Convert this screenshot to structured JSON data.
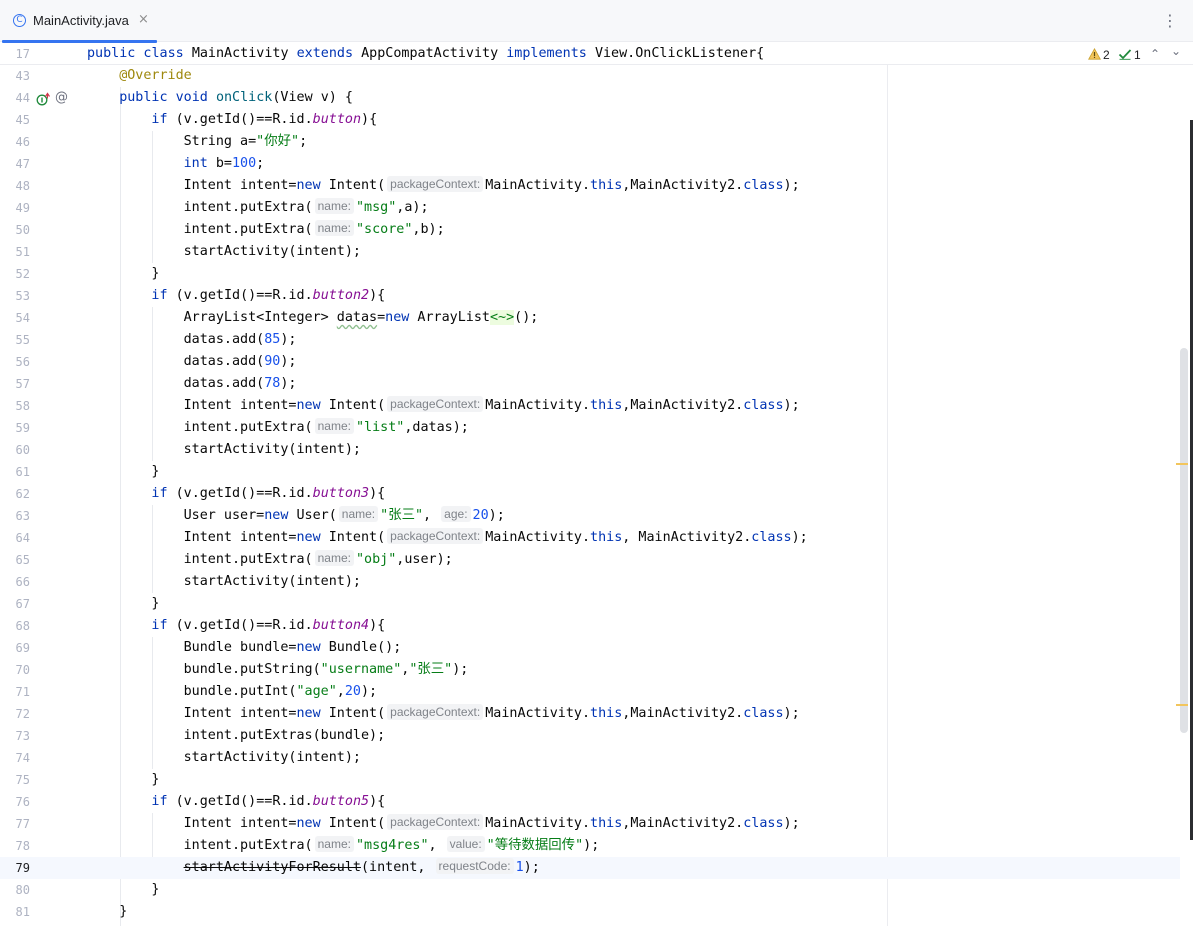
{
  "tab": {
    "icon_letter": "C",
    "filename": "MainActivity.java",
    "close_glyph": "×"
  },
  "more_glyph": "⋮",
  "inspection": {
    "warning_count": "2",
    "ok_count": "1",
    "up_glyph": "⌃",
    "down_glyph": "⌄"
  },
  "sticky": {
    "line_number": "17",
    "tokens": [
      {
        "t": "public class ",
        "c": "kw"
      },
      {
        "t": "MainActivity "
      },
      {
        "t": "extends ",
        "c": "kw"
      },
      {
        "t": "AppCompatActivity "
      },
      {
        "t": "implements ",
        "c": "kw"
      },
      {
        "t": "View.OnClickListener{"
      }
    ]
  },
  "current_line": "79",
  "lines": [
    {
      "n": "43",
      "i": 1,
      "tokens": [
        {
          "t": "@Override",
          "c": "ann"
        }
      ]
    },
    {
      "n": "44",
      "i": 1,
      "tokens": [
        {
          "t": "public void ",
          "c": "kw"
        },
        {
          "t": "onClick",
          "c": "fn"
        },
        {
          "t": "(View v) {"
        }
      ]
    },
    {
      "n": "45",
      "i": 2,
      "tokens": [
        {
          "t": "if ",
          "c": "kw"
        },
        {
          "t": "(v.getId()==R.id."
        },
        {
          "t": "button",
          "c": "fld"
        },
        {
          "t": "){"
        }
      ]
    },
    {
      "n": "46",
      "i": 3,
      "tokens": [
        {
          "t": "String a="
        },
        {
          "t": "\"你好\"",
          "c": "str"
        },
        {
          "t": ";"
        }
      ]
    },
    {
      "n": "47",
      "i": 3,
      "tokens": [
        {
          "t": "int ",
          "c": "kw"
        },
        {
          "t": "b="
        },
        {
          "t": "100",
          "c": "num"
        },
        {
          "t": ";"
        }
      ]
    },
    {
      "n": "48",
      "i": 3,
      "tokens": [
        {
          "t": "Intent intent="
        },
        {
          "t": "new ",
          "c": "kw"
        },
        {
          "t": "Intent("
        },
        {
          "h": "packageContext:"
        },
        {
          "t": "MainActivity."
        },
        {
          "t": "this",
          "c": "kw"
        },
        {
          "t": ",MainActivity2."
        },
        {
          "t": "class",
          "c": "kw"
        },
        {
          "t": ");"
        }
      ]
    },
    {
      "n": "49",
      "i": 3,
      "tokens": [
        {
          "t": "intent.putExtra("
        },
        {
          "h": "name:"
        },
        {
          "t": "\"msg\"",
          "c": "str"
        },
        {
          "t": ",a);"
        }
      ]
    },
    {
      "n": "50",
      "i": 3,
      "tokens": [
        {
          "t": "intent.putExtra("
        },
        {
          "h": "name:"
        },
        {
          "t": "\"score\"",
          "c": "str"
        },
        {
          "t": ",b);"
        }
      ]
    },
    {
      "n": "51",
      "i": 3,
      "tokens": [
        {
          "t": "startActivity(intent);"
        }
      ]
    },
    {
      "n": "52",
      "i": 2,
      "tokens": [
        {
          "t": "}"
        }
      ]
    },
    {
      "n": "53",
      "i": 2,
      "tokens": [
        {
          "t": "if ",
          "c": "kw"
        },
        {
          "t": "(v.getId()==R.id."
        },
        {
          "t": "button2",
          "c": "fld"
        },
        {
          "t": "){"
        }
      ]
    },
    {
      "n": "54",
      "i": 3,
      "tokens": [
        {
          "t": "ArrayList<Integer> "
        },
        {
          "t": "datas",
          "c": "wavy"
        },
        {
          "t": "="
        },
        {
          "t": "new ",
          "c": "kw"
        },
        {
          "t": "ArrayList"
        },
        {
          "t": "<~>",
          "c": "diam"
        },
        {
          "t": "();"
        }
      ]
    },
    {
      "n": "55",
      "i": 3,
      "tokens": [
        {
          "t": "datas.add("
        },
        {
          "t": "85",
          "c": "num"
        },
        {
          "t": ");"
        }
      ]
    },
    {
      "n": "56",
      "i": 3,
      "tokens": [
        {
          "t": "datas.add("
        },
        {
          "t": "90",
          "c": "num"
        },
        {
          "t": ");"
        }
      ]
    },
    {
      "n": "57",
      "i": 3,
      "tokens": [
        {
          "t": "datas.add("
        },
        {
          "t": "78",
          "c": "num"
        },
        {
          "t": ");"
        }
      ]
    },
    {
      "n": "58",
      "i": 3,
      "tokens": [
        {
          "t": "Intent intent="
        },
        {
          "t": "new ",
          "c": "kw"
        },
        {
          "t": "Intent("
        },
        {
          "h": "packageContext:"
        },
        {
          "t": "MainActivity."
        },
        {
          "t": "this",
          "c": "kw"
        },
        {
          "t": ",MainActivity2."
        },
        {
          "t": "class",
          "c": "kw"
        },
        {
          "t": ");"
        }
      ]
    },
    {
      "n": "59",
      "i": 3,
      "tokens": [
        {
          "t": "intent.putExtra("
        },
        {
          "h": "name:"
        },
        {
          "t": "\"list\"",
          "c": "str"
        },
        {
          "t": ",datas);"
        }
      ]
    },
    {
      "n": "60",
      "i": 3,
      "tokens": [
        {
          "t": "startActivity(intent);"
        }
      ]
    },
    {
      "n": "61",
      "i": 2,
      "tokens": [
        {
          "t": "}"
        }
      ]
    },
    {
      "n": "62",
      "i": 2,
      "tokens": [
        {
          "t": "if ",
          "c": "kw"
        },
        {
          "t": "(v.getId()==R.id."
        },
        {
          "t": "button3",
          "c": "fld"
        },
        {
          "t": "){"
        }
      ]
    },
    {
      "n": "63",
      "i": 3,
      "tokens": [
        {
          "t": "User user="
        },
        {
          "t": "new ",
          "c": "kw"
        },
        {
          "t": "User("
        },
        {
          "h": "name:"
        },
        {
          "t": "\"张三\"",
          "c": "str"
        },
        {
          "t": ", "
        },
        {
          "h": "age:"
        },
        {
          "t": "20",
          "c": "num"
        },
        {
          "t": ");"
        }
      ]
    },
    {
      "n": "64",
      "i": 3,
      "tokens": [
        {
          "t": "Intent intent="
        },
        {
          "t": "new ",
          "c": "kw"
        },
        {
          "t": "Intent("
        },
        {
          "h": "packageContext:"
        },
        {
          "t": "MainActivity."
        },
        {
          "t": "this",
          "c": "kw"
        },
        {
          "t": ", MainActivity2."
        },
        {
          "t": "class",
          "c": "kw"
        },
        {
          "t": ");"
        }
      ]
    },
    {
      "n": "65",
      "i": 3,
      "tokens": [
        {
          "t": "intent.putExtra("
        },
        {
          "h": "name:"
        },
        {
          "t": "\"obj\"",
          "c": "str"
        },
        {
          "t": ",user);"
        }
      ]
    },
    {
      "n": "66",
      "i": 3,
      "tokens": [
        {
          "t": "startActivity(intent);"
        }
      ]
    },
    {
      "n": "67",
      "i": 2,
      "tokens": [
        {
          "t": "}"
        }
      ]
    },
    {
      "n": "68",
      "i": 2,
      "tokens": [
        {
          "t": "if ",
          "c": "kw"
        },
        {
          "t": "(v.getId()==R.id."
        },
        {
          "t": "button4",
          "c": "fld"
        },
        {
          "t": "){"
        }
      ]
    },
    {
      "n": "69",
      "i": 3,
      "tokens": [
        {
          "t": "Bundle bundle="
        },
        {
          "t": "new ",
          "c": "kw"
        },
        {
          "t": "Bundle();"
        }
      ]
    },
    {
      "n": "70",
      "i": 3,
      "tokens": [
        {
          "t": "bundle.putString("
        },
        {
          "t": "\"username\"",
          "c": "str"
        },
        {
          "t": ","
        },
        {
          "t": "\"张三\"",
          "c": "str"
        },
        {
          "t": ");"
        }
      ]
    },
    {
      "n": "71",
      "i": 3,
      "tokens": [
        {
          "t": "bundle.putInt("
        },
        {
          "t": "\"age\"",
          "c": "str"
        },
        {
          "t": ","
        },
        {
          "t": "20",
          "c": "num"
        },
        {
          "t": ");"
        }
      ]
    },
    {
      "n": "72",
      "i": 3,
      "tokens": [
        {
          "t": "Intent intent="
        },
        {
          "t": "new ",
          "c": "kw"
        },
        {
          "t": "Intent("
        },
        {
          "h": "packageContext:"
        },
        {
          "t": "MainActivity."
        },
        {
          "t": "this",
          "c": "kw"
        },
        {
          "t": ",MainActivity2."
        },
        {
          "t": "class",
          "c": "kw"
        },
        {
          "t": ");"
        }
      ]
    },
    {
      "n": "73",
      "i": 3,
      "tokens": [
        {
          "t": "intent.putExtras(bundle);"
        }
      ]
    },
    {
      "n": "74",
      "i": 3,
      "tokens": [
        {
          "t": "startActivity(intent);"
        }
      ]
    },
    {
      "n": "75",
      "i": 2,
      "tokens": [
        {
          "t": "}"
        }
      ]
    },
    {
      "n": "76",
      "i": 2,
      "tokens": [
        {
          "t": "if ",
          "c": "kw"
        },
        {
          "t": "(v.getId()==R.id."
        },
        {
          "t": "button5",
          "c": "fld"
        },
        {
          "t": "){"
        }
      ]
    },
    {
      "n": "77",
      "i": 3,
      "tokens": [
        {
          "t": "Intent intent="
        },
        {
          "t": "new ",
          "c": "kw"
        },
        {
          "t": "Intent("
        },
        {
          "h": "packageContext:"
        },
        {
          "t": "MainActivity."
        },
        {
          "t": "this",
          "c": "kw"
        },
        {
          "t": ",MainActivity2."
        },
        {
          "t": "class",
          "c": "kw"
        },
        {
          "t": ");"
        }
      ]
    },
    {
      "n": "78",
      "i": 3,
      "tokens": [
        {
          "t": "intent.putExtra("
        },
        {
          "h": "name:"
        },
        {
          "t": "\"msg4res\"",
          "c": "str"
        },
        {
          "t": ", "
        },
        {
          "h": "value:"
        },
        {
          "t": "\"等待数据回传\"",
          "c": "str"
        },
        {
          "t": ");"
        }
      ]
    },
    {
      "n": "79",
      "i": 3,
      "tokens": [
        {
          "t": "startActivityForResult",
          "c": "strike"
        },
        {
          "t": "(intent, "
        },
        {
          "h": "requestCode:"
        },
        {
          "t": "1",
          "c": "num"
        },
        {
          "t": ");"
        }
      ]
    },
    {
      "n": "80",
      "i": 2,
      "tokens": [
        {
          "t": "}"
        }
      ]
    },
    {
      "n": "81",
      "i": 1,
      "tokens": [
        {
          "t": "}"
        }
      ]
    }
  ],
  "colors": {
    "keyword": "#0033b3",
    "annotation": "#9e880d",
    "method": "#00627a",
    "string": "#067d17",
    "number": "#1750eb",
    "field": "#871094",
    "accent": "#3574f0"
  }
}
